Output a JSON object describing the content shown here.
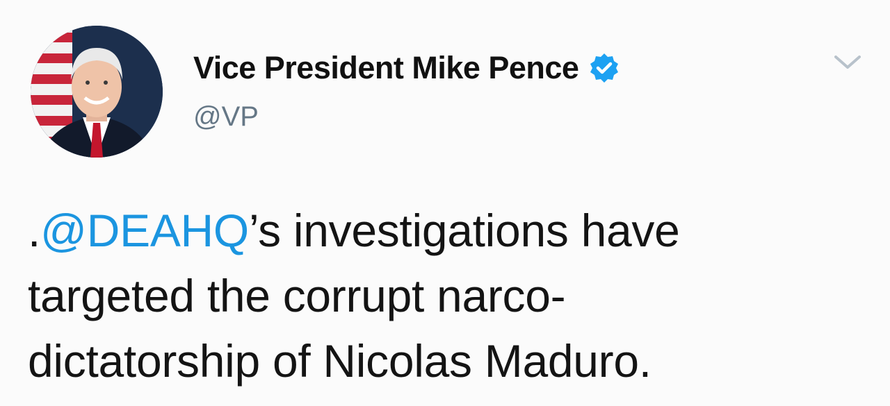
{
  "user": {
    "display_name": "Vice President Mike Pence",
    "handle": "@VP",
    "verified_icon": "verified-badge-icon",
    "avatar": "profile-photo"
  },
  "menu": {
    "caret_icon": "chevron-down-icon"
  },
  "tweet": {
    "prefix": ".",
    "mention": "@DEAHQ",
    "line1_rest": "’s investigations have",
    "line2": "targeted the corrupt narco-",
    "line3": "dictatorship of Nicolas Maduro."
  },
  "colors": {
    "link": "#1b95e0",
    "verified": "#1da1f2",
    "secondary_text": "#657786",
    "primary_text": "#141414"
  }
}
